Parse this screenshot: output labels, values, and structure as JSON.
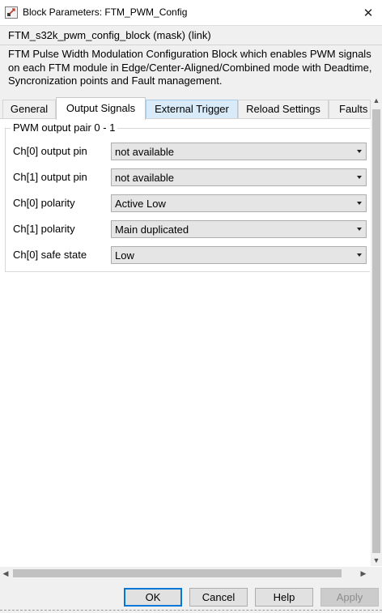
{
  "window": {
    "title": "Block Parameters: FTM_PWM_Config",
    "close_glyph": "✕"
  },
  "block": {
    "name": "FTM_s32k_pwm_config_block (mask) (link)",
    "description_lines": [
      "FTM Pulse Width Modulation Configuration Block which enables PWM signals",
      "on each FTM module in Edge/Center-Aligned/Combined mode with Deadtime,",
      "Syncronization points and Fault management."
    ]
  },
  "tabs": [
    {
      "label": "General"
    },
    {
      "label": "Output Signals"
    },
    {
      "label": "External Trigger"
    },
    {
      "label": "Reload Settings"
    },
    {
      "label": "Faults"
    }
  ],
  "active_tab": "Output Signals",
  "group": {
    "label": "PWM output pair 0 - 1",
    "rows": [
      {
        "label": "Ch[0] output pin",
        "value": "not available"
      },
      {
        "label": "Ch[1] output pin",
        "value": "not available"
      },
      {
        "label": "Ch[0] polarity",
        "value": "Active Low"
      },
      {
        "label": "Ch[1] polarity",
        "value": "Main duplicated"
      },
      {
        "label": "Ch[0] safe state",
        "value": "Low"
      }
    ]
  },
  "scroll": {
    "up": "▲",
    "down": "▼",
    "left": "◀",
    "right": "▶"
  },
  "buttons": {
    "ok": "OK",
    "cancel": "Cancel",
    "help": "Help",
    "apply": "Apply"
  },
  "colors": {
    "dialog_bg": "#f0f0f0",
    "tab_hover_bg": "#d9ebf9",
    "default_button_border": "#0078d7",
    "dropdown_bg": "#e5e5e5"
  },
  "icons": [
    "simulink-block-icon",
    "close-icon",
    "dropdown-arrow-icon"
  ]
}
